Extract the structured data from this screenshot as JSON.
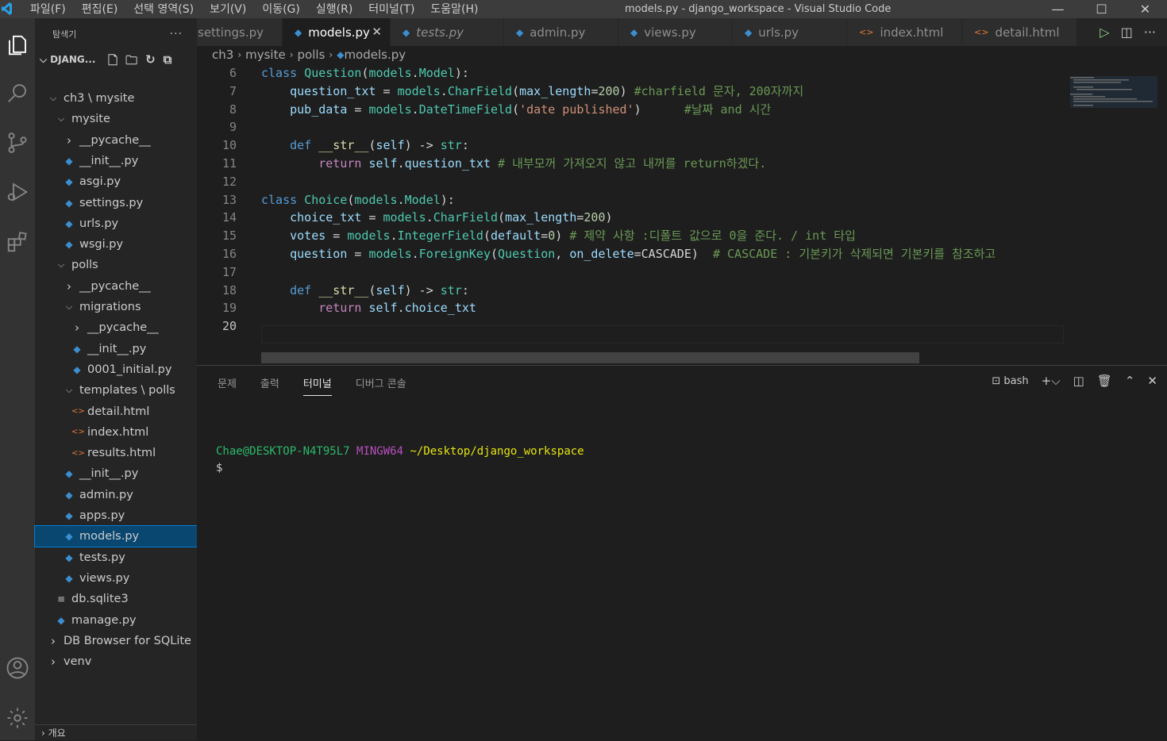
{
  "menu": [
    "파일(F)",
    "편집(E)",
    "선택 영역(S)",
    "보기(V)",
    "이동(G)",
    "실행(R)",
    "터미널(T)",
    "도움말(H)"
  ],
  "window_title": "models.py - django_workspace - Visual Studio Code",
  "sidebar": {
    "title": "탐색기",
    "project": "DJANG...",
    "outline": "개요",
    "tree": [
      {
        "label": "ch3 \\ mysite",
        "type": "folder-open",
        "depth": 1
      },
      {
        "label": "mysite",
        "type": "folder-open",
        "depth": 2
      },
      {
        "label": "__pycache__",
        "type": "folder",
        "depth": 3
      },
      {
        "label": "__init__.py",
        "type": "py",
        "depth": 3
      },
      {
        "label": "asgi.py",
        "type": "py",
        "depth": 3
      },
      {
        "label": "settings.py",
        "type": "py",
        "depth": 3
      },
      {
        "label": "urls.py",
        "type": "py",
        "depth": 3
      },
      {
        "label": "wsgi.py",
        "type": "py",
        "depth": 3
      },
      {
        "label": "polls",
        "type": "folder-open",
        "depth": 2
      },
      {
        "label": "__pycache__",
        "type": "folder",
        "depth": 3
      },
      {
        "label": "migrations",
        "type": "folder-open",
        "depth": 3
      },
      {
        "label": "__pycache__",
        "type": "folder",
        "depth": 4
      },
      {
        "label": "__init__.py",
        "type": "py",
        "depth": 4
      },
      {
        "label": "0001_initial.py",
        "type": "py",
        "depth": 4
      },
      {
        "label": "templates \\ polls",
        "type": "folder-open",
        "depth": 3
      },
      {
        "label": "detail.html",
        "type": "html",
        "depth": 4
      },
      {
        "label": "index.html",
        "type": "html",
        "depth": 4
      },
      {
        "label": "results.html",
        "type": "html",
        "depth": 4
      },
      {
        "label": "__init__.py",
        "type": "py",
        "depth": 3
      },
      {
        "label": "admin.py",
        "type": "py",
        "depth": 3
      },
      {
        "label": "apps.py",
        "type": "py",
        "depth": 3
      },
      {
        "label": "models.py",
        "type": "py",
        "depth": 3,
        "selected": true
      },
      {
        "label": "tests.py",
        "type": "py",
        "depth": 3
      },
      {
        "label": "views.py",
        "type": "py",
        "depth": 3
      },
      {
        "label": "db.sqlite3",
        "type": "db",
        "depth": 2
      },
      {
        "label": "manage.py",
        "type": "py",
        "depth": 2
      },
      {
        "label": "DB Browser for SQLite",
        "type": "folder",
        "depth": 1
      },
      {
        "label": "venv",
        "type": "folder",
        "depth": 1
      }
    ]
  },
  "tabs": [
    {
      "label": "settings.py",
      "icon": "none",
      "active": false,
      "italic": false
    },
    {
      "label": "models.py",
      "icon": "python-icon",
      "active": true,
      "italic": false
    },
    {
      "label": "tests.py",
      "icon": "python-icon",
      "active": false,
      "italic": true
    },
    {
      "label": "admin.py",
      "icon": "python-icon",
      "active": false,
      "italic": false
    },
    {
      "label": "views.py",
      "icon": "python-icon",
      "active": false,
      "italic": false
    },
    {
      "label": "urls.py",
      "icon": "python-icon",
      "active": false,
      "italic": false
    },
    {
      "label": "index.html",
      "icon": "html-icon",
      "active": false,
      "italic": false
    },
    {
      "label": "detail.html",
      "icon": "html-icon",
      "active": false,
      "italic": false
    }
  ],
  "breadcrumb": [
    "ch3",
    "mysite",
    "polls",
    "models.py"
  ],
  "code": [
    {
      "n": "6",
      "tokens": [
        [
          "kw",
          "class "
        ],
        [
          "cls",
          "Question"
        ],
        [
          "pl",
          "("
        ],
        [
          "cls",
          "models"
        ],
        [
          "pl",
          "."
        ],
        [
          "cls",
          "Model"
        ],
        [
          "pl",
          "):"
        ]
      ]
    },
    {
      "n": "7",
      "tokens": [
        [
          "pl",
          "    "
        ],
        [
          "var",
          "question_txt"
        ],
        [
          "pl",
          " = "
        ],
        [
          "cls",
          "models"
        ],
        [
          "pl",
          "."
        ],
        [
          "cls",
          "CharField"
        ],
        [
          "pl",
          "("
        ],
        [
          "var",
          "max_length"
        ],
        [
          "pl",
          "="
        ],
        [
          "num",
          "200"
        ],
        [
          "pl",
          ") "
        ],
        [
          "cm",
          "#charfield 문자, 200자까지"
        ]
      ]
    },
    {
      "n": "8",
      "tokens": [
        [
          "pl",
          "    "
        ],
        [
          "var",
          "pub_data"
        ],
        [
          "pl",
          " = "
        ],
        [
          "cls",
          "models"
        ],
        [
          "pl",
          "."
        ],
        [
          "cls",
          "DateTimeField"
        ],
        [
          "pl",
          "("
        ],
        [
          "str",
          "'date published'"
        ],
        [
          "pl",
          ")      "
        ],
        [
          "cm",
          "#날짜 and 시간"
        ]
      ]
    },
    {
      "n": "9",
      "tokens": []
    },
    {
      "n": "10",
      "tokens": [
        [
          "pl",
          "    "
        ],
        [
          "kw",
          "def "
        ],
        [
          "fn",
          "__str__"
        ],
        [
          "pl",
          "("
        ],
        [
          "var",
          "self"
        ],
        [
          "pl",
          ") -> "
        ],
        [
          "cls",
          "str"
        ],
        [
          "pl",
          ":"
        ]
      ]
    },
    {
      "n": "11",
      "tokens": [
        [
          "pl",
          "        "
        ],
        [
          "ctrl",
          "return "
        ],
        [
          "var",
          "self"
        ],
        [
          "pl",
          "."
        ],
        [
          "var",
          "question_txt"
        ],
        [
          "pl",
          " "
        ],
        [
          "cm",
          "# 내부모꺼 가져오지 않고 내꺼를 return하겠다."
        ]
      ]
    },
    {
      "n": "12",
      "tokens": []
    },
    {
      "n": "13",
      "tokens": [
        [
          "kw",
          "class "
        ],
        [
          "cls",
          "Choice"
        ],
        [
          "pl",
          "("
        ],
        [
          "cls",
          "models"
        ],
        [
          "pl",
          "."
        ],
        [
          "cls",
          "Model"
        ],
        [
          "pl",
          "):"
        ]
      ]
    },
    {
      "n": "14",
      "tokens": [
        [
          "pl",
          "    "
        ],
        [
          "var",
          "choice_txt"
        ],
        [
          "pl",
          " = "
        ],
        [
          "cls",
          "models"
        ],
        [
          "pl",
          "."
        ],
        [
          "cls",
          "CharField"
        ],
        [
          "pl",
          "("
        ],
        [
          "var",
          "max_length"
        ],
        [
          "pl",
          "="
        ],
        [
          "num",
          "200"
        ],
        [
          "pl",
          ")"
        ]
      ]
    },
    {
      "n": "15",
      "tokens": [
        [
          "pl",
          "    "
        ],
        [
          "var",
          "votes"
        ],
        [
          "pl",
          " = "
        ],
        [
          "cls",
          "models"
        ],
        [
          "pl",
          "."
        ],
        [
          "cls",
          "IntegerField"
        ],
        [
          "pl",
          "("
        ],
        [
          "var",
          "default"
        ],
        [
          "pl",
          "="
        ],
        [
          "num",
          "0"
        ],
        [
          "pl",
          ") "
        ],
        [
          "cm",
          "# 제약 사항 :디폴트 값으로 0을 준다. / int 타입"
        ]
      ]
    },
    {
      "n": "16",
      "tokens": [
        [
          "pl",
          "    "
        ],
        [
          "var",
          "question"
        ],
        [
          "pl",
          " = "
        ],
        [
          "cls",
          "models"
        ],
        [
          "pl",
          "."
        ],
        [
          "cls",
          "ForeignKey"
        ],
        [
          "pl",
          "("
        ],
        [
          "cls",
          "Question"
        ],
        [
          "pl",
          ", "
        ],
        [
          "var",
          "on_delete"
        ],
        [
          "pl",
          "=CASCADE)  "
        ],
        [
          "cm",
          "# CASCADE : 기본키가 삭제되면 기본키를 참조하고"
        ]
      ]
    },
    {
      "n": "17",
      "tokens": []
    },
    {
      "n": "18",
      "tokens": [
        [
          "pl",
          "    "
        ],
        [
          "kw",
          "def "
        ],
        [
          "fn",
          "__str__"
        ],
        [
          "pl",
          "("
        ],
        [
          "var",
          "self"
        ],
        [
          "pl",
          ") -> "
        ],
        [
          "cls",
          "str"
        ],
        [
          "pl",
          ":"
        ]
      ]
    },
    {
      "n": "19",
      "tokens": [
        [
          "pl",
          "        "
        ],
        [
          "ctrl",
          "return "
        ],
        [
          "var",
          "self"
        ],
        [
          "pl",
          "."
        ],
        [
          "var",
          "choice_txt"
        ]
      ]
    },
    {
      "n": "20",
      "tokens": [],
      "current": true
    }
  ],
  "panel": {
    "tabs": [
      "문제",
      "출력",
      "터미널",
      "디버그 콘솔"
    ],
    "active_tab": "터미널",
    "shell": "bash",
    "terminal_user": "Chae@DESKTOP-N4T95L7",
    "terminal_env": "MINGW64",
    "terminal_path": "~/Desktop/django_workspace",
    "prompt": "$"
  },
  "colors": {
    "accent": "#007acc",
    "selection": "#094771",
    "activity_bar": "#333333",
    "sidebar": "#252526"
  }
}
